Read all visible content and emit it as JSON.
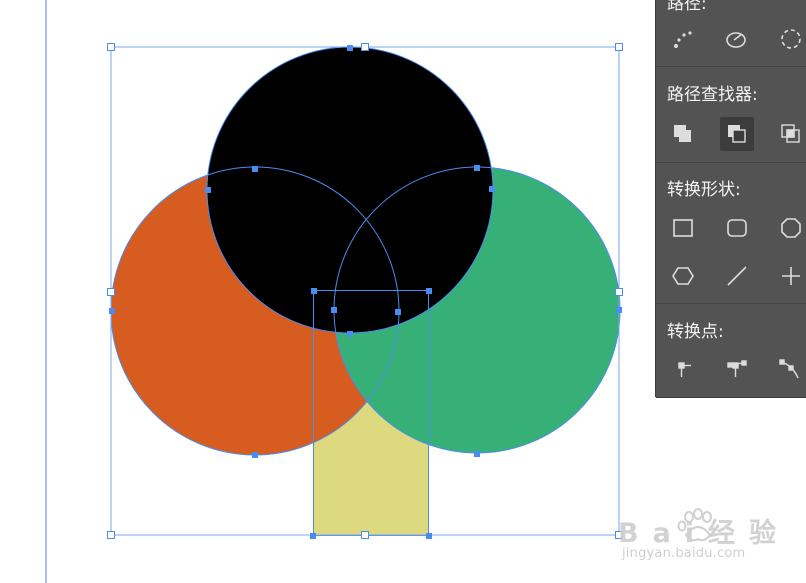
{
  "panel": {
    "section_path": "路径:",
    "section_pathfinder": "路径查找器:",
    "section_convert_shape": "转换形状:",
    "section_convert_point": "转换点:",
    "pathfinder_selected": "subtract-front"
  },
  "colors": {
    "panel_bg": "#535353",
    "black_circle": "#000000",
    "orange_circle": "#d65c20",
    "green_circle": "#36b077",
    "yellow_rect": "#dcd97e",
    "selection_blue": "#4a8cf0"
  },
  "watermark": {
    "brand_text": "Bai经验",
    "url": "jingyan.baidu.com"
  }
}
